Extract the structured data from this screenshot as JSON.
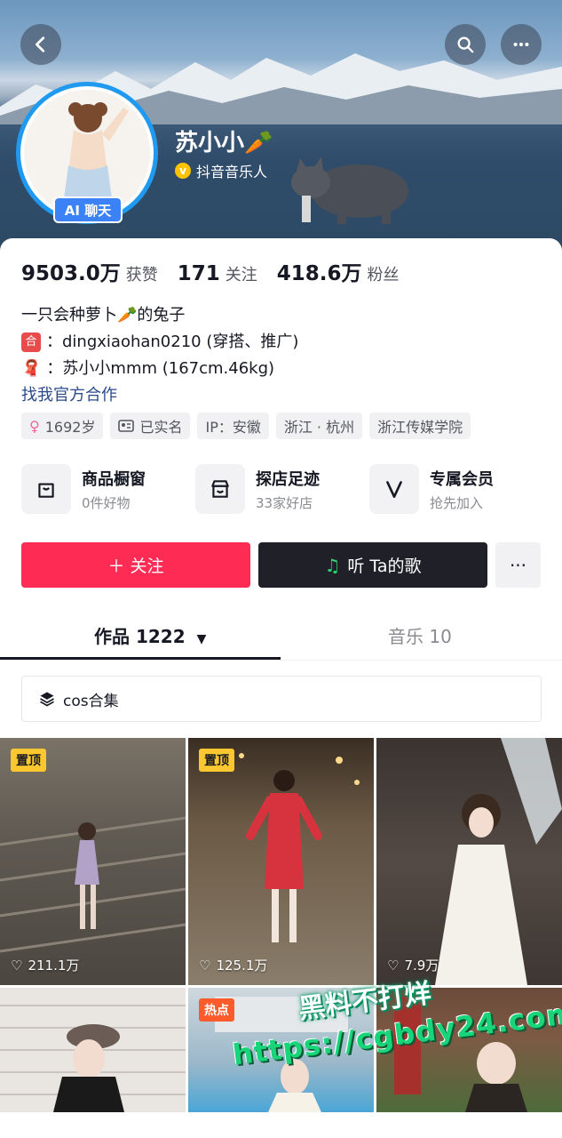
{
  "header": {
    "back_icon": "chevron-left-icon",
    "search_icon": "search-icon",
    "more_icon": "more-dots-icon"
  },
  "profile": {
    "name": "苏小小🥕",
    "ai_badge": "AI 聊天",
    "verified_text": "抖音音乐人",
    "verified_icon": "v"
  },
  "stats": [
    {
      "num": "9503.0万",
      "label": "获赞"
    },
    {
      "num": "171",
      "label": "关注"
    },
    {
      "num": "418.6万",
      "label": "粉丝"
    }
  ],
  "bio": {
    "line1": "一只会种萝卜🥕的兔子",
    "line2_icon": "合",
    "line2": "：dingxiaohan0210 (穿搭、推广)",
    "line3_icon": "🧣",
    "line3": "：苏小小mmm (167cm.46kg)",
    "link": "找我官方合作"
  },
  "chips": [
    {
      "icon": "♀",
      "text": "1692岁"
    },
    {
      "icon": "id-card-icon",
      "text": "已实名"
    },
    {
      "text": "IP：安徽"
    },
    {
      "text": "浙江 · 杭州"
    },
    {
      "text": "浙江传媒学院"
    }
  ],
  "services": [
    {
      "title": "商品橱窗",
      "sub": "0件好物",
      "icon": "shopping-bag-icon"
    },
    {
      "title": "探店足迹",
      "sub": "33家好店",
      "icon": "store-icon"
    },
    {
      "title": "专属会员",
      "sub": "抢先加入",
      "icon": "v-member-icon"
    }
  ],
  "actions": {
    "follow": "＋ 关注",
    "song": "听 Ta的歌",
    "more": "···"
  },
  "tabs": {
    "works": "作品 1222",
    "music": "音乐 10"
  },
  "collection": "cos合集",
  "videos": [
    {
      "badge": "置顶",
      "likes": "211.1万"
    },
    {
      "badge": "置顶",
      "likes": "125.1万"
    },
    {
      "badge": "",
      "likes": "7.9万"
    },
    {
      "badge": "",
      "likes": ""
    },
    {
      "badge": "热点",
      "likes": ""
    },
    {
      "badge": "",
      "likes": ""
    }
  ],
  "watermark": {
    "line1": "黑料不打烊",
    "line2": "https://cgbdy24.com"
  },
  "colors": {
    "follow": "#fe2c55",
    "song_btn": "#1f2028",
    "avatar_ring": "#1f9af0",
    "pin": "#fdc82f"
  }
}
